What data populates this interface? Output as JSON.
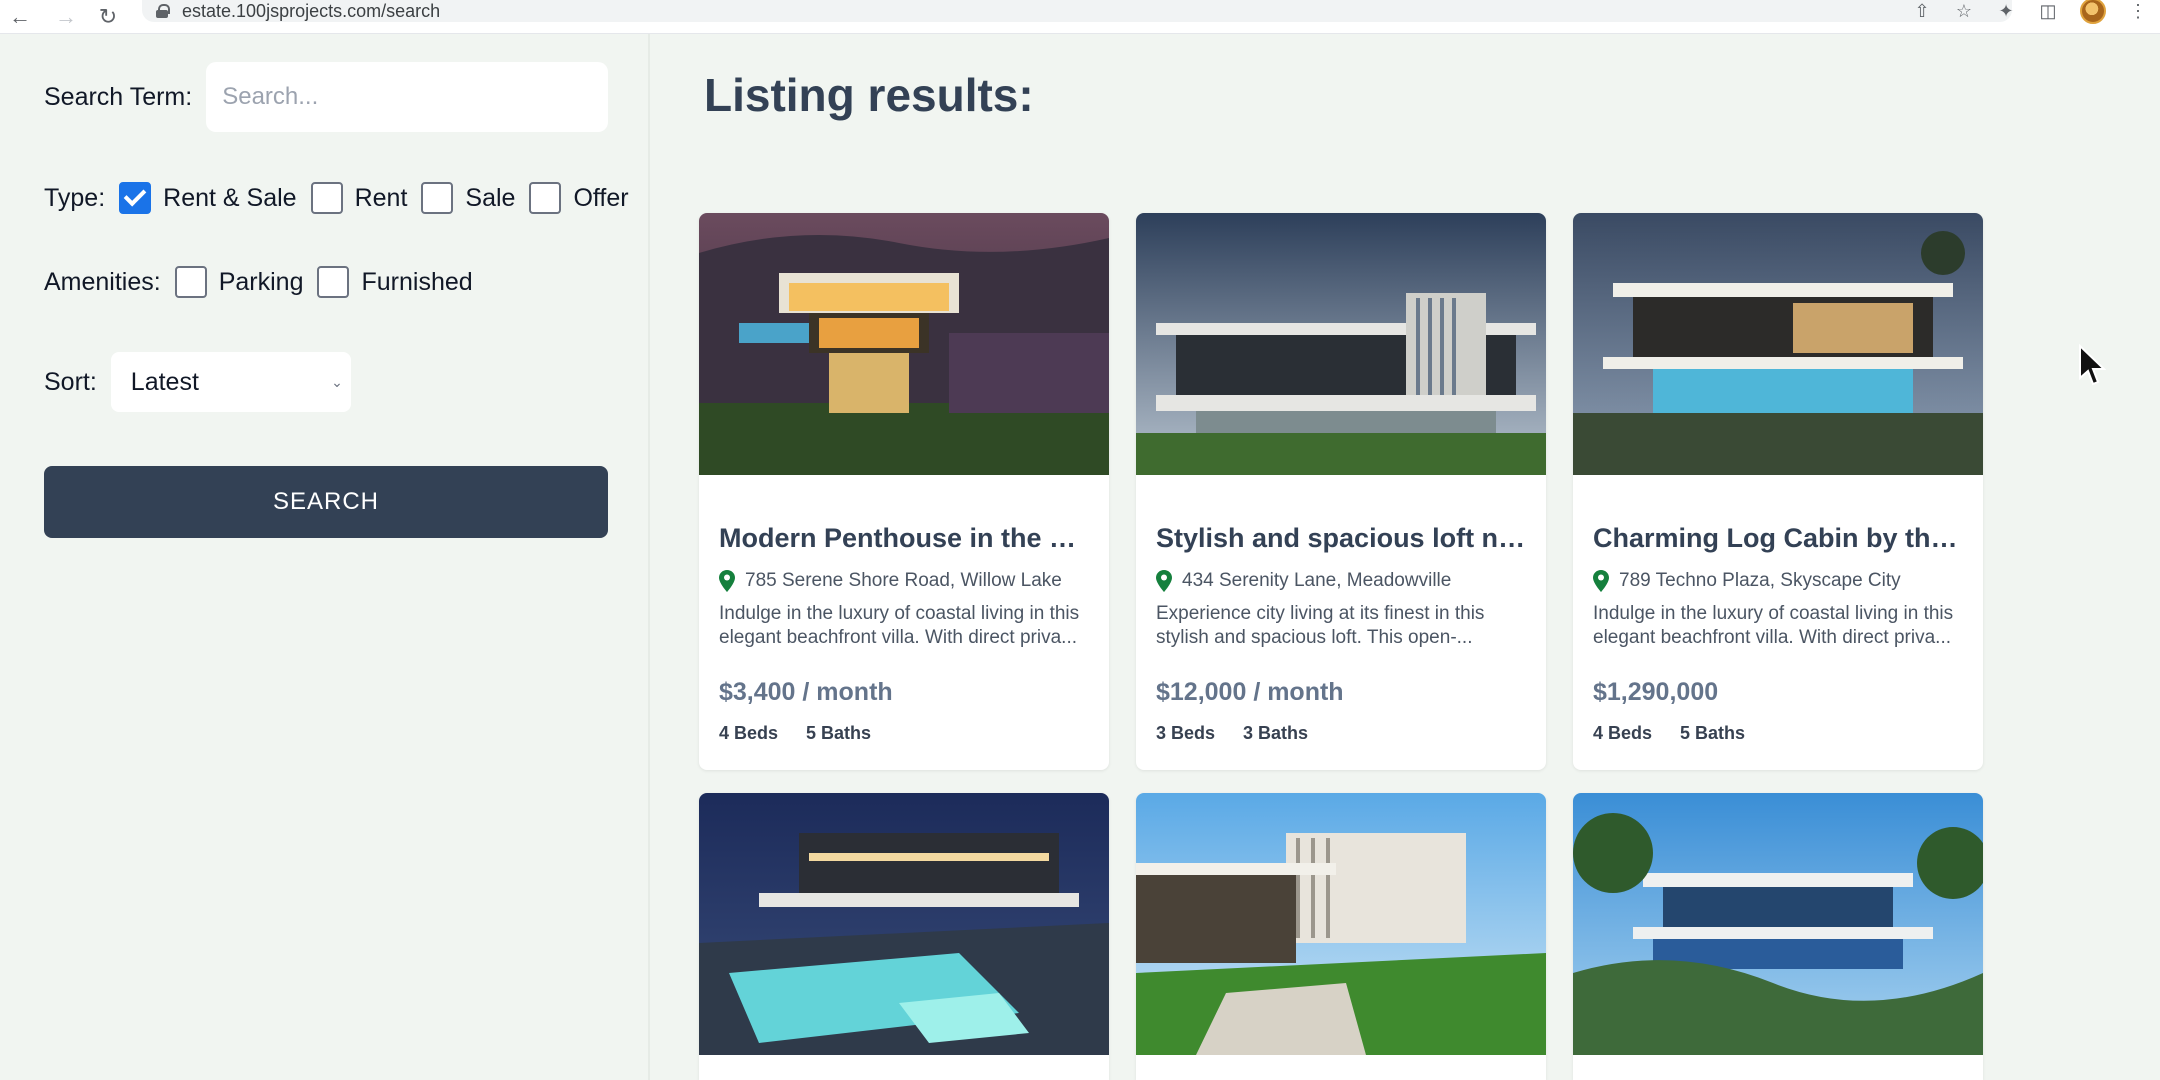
{
  "browser": {
    "url": "estate.100jsprojects.com/search"
  },
  "filters": {
    "search_label": "Search Term:",
    "search_placeholder": "Search...",
    "search_value": "",
    "type_label": "Type:",
    "type_options": [
      {
        "label": "Rent & Sale",
        "checked": true
      },
      {
        "label": "Rent",
        "checked": false
      },
      {
        "label": "Sale",
        "checked": false
      },
      {
        "label": "Offer",
        "checked": false
      }
    ],
    "amenities_label": "Amenities:",
    "amenities_options": [
      {
        "label": "Parking",
        "checked": false
      },
      {
        "label": "Furnished",
        "checked": false
      }
    ],
    "sort_label": "Sort:",
    "sort_value": "Latest",
    "search_button": "SEARCH"
  },
  "results": {
    "title": "Listing results:",
    "listings": [
      {
        "title": "Modern Penthouse in the Cl...",
        "address": "785 Serene Shore Road, Willow Lake",
        "description": "Indulge in the luxury of coastal living in this elegant beachfront villa. With direct priva...",
        "price": "$3,400 / month",
        "beds": "4 Beds",
        "baths": "5 Baths"
      },
      {
        "title": "Stylish and spacious loft ne...",
        "address": "434 Serenity Lane, Meadowville",
        "description": "Experience city living at its finest in this stylish and spacious loft. This open-...",
        "price": "$12,000 / month",
        "beds": "3 Beds",
        "baths": "3 Baths"
      },
      {
        "title": "Charming Log Cabin by the ...",
        "address": "789 Techno Plaza, Skyscape City",
        "description": "Indulge in the luxury of coastal living in this elegant beachfront villa. With direct priva...",
        "price": "$1,290,000",
        "beds": "4 Beds",
        "baths": "5 Baths"
      }
    ]
  },
  "colors": {
    "accent": "#334155",
    "pin": "#15803d",
    "checkbox": "#1a73e8"
  }
}
